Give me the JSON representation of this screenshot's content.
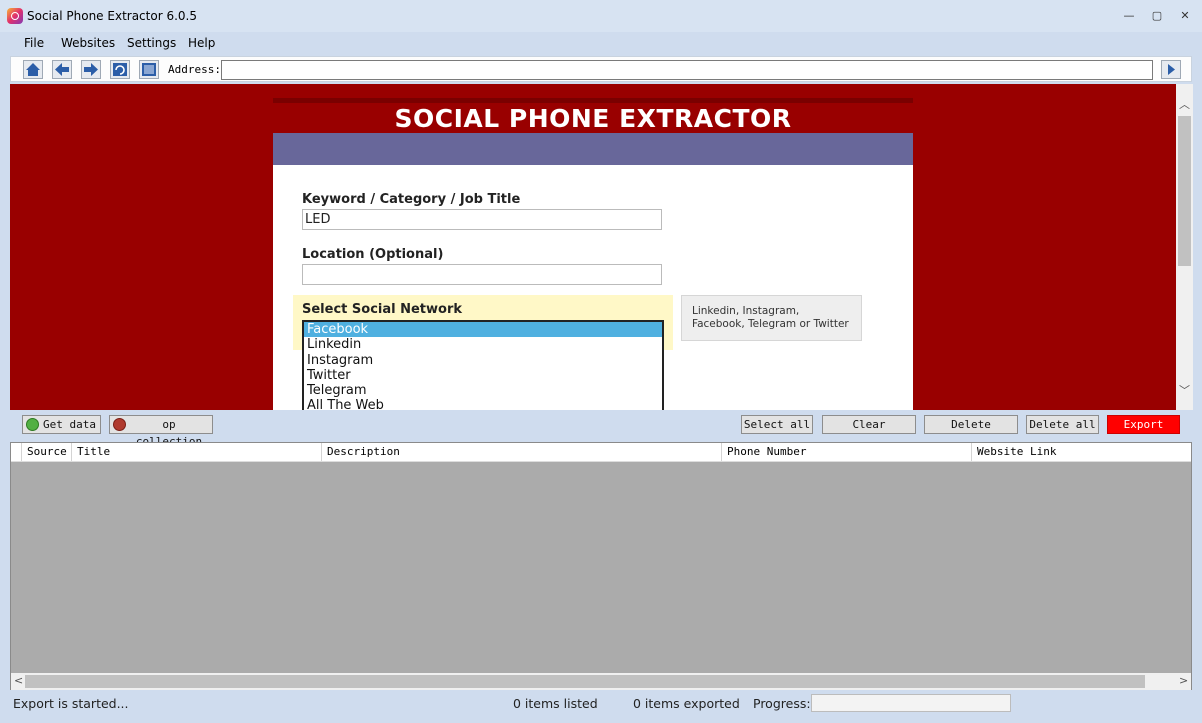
{
  "window": {
    "title": "Social Phone Extractor 6.0.5",
    "minimize": "—",
    "restore": "▢",
    "close": "✕"
  },
  "menu": [
    "File",
    "Websites",
    "Settings",
    "Help"
  ],
  "toolbar": {
    "address_label": "Address:",
    "address_value": ""
  },
  "page": {
    "heading": "SOCIAL PHONE EXTRACTOR",
    "keyword_label": "Keyword / Category / Job Title",
    "keyword_value": "LED",
    "location_label": "Location (Optional)",
    "location_value": "",
    "network_label": "Select Social Network",
    "networks": [
      "Facebook",
      "Linkedin",
      "Instagram",
      "Twitter",
      "Telegram",
      "All The Web"
    ],
    "selected_network": "Facebook",
    "hint": "Linkedin, Instagram, Facebook, Telegram or Twitter"
  },
  "actions": {
    "get_data": "Get data",
    "stop_collection": "op collection",
    "select_all": "Select all",
    "clear": "Clear",
    "delete": "Delete",
    "delete_all": "Delete all",
    "export": "Export"
  },
  "table": {
    "columns": [
      "Source",
      "Title",
      "Description",
      "Phone Number",
      "Website Link"
    ],
    "rows": []
  },
  "status": {
    "message": "Export is started...",
    "listed": "0 items listed",
    "exported": "0 items exported",
    "progress_label": "Progress:",
    "progress": 0
  },
  "colors": {
    "page_bg": "#990000",
    "band": "#68679a",
    "selected": "#4fb0e0",
    "export": "#ff0000"
  },
  "icons": [
    "app-icon",
    "home-icon",
    "back-icon",
    "forward-icon",
    "refresh-icon",
    "stop-icon",
    "go-icon",
    "play-icon",
    "stop-circle-icon"
  ]
}
